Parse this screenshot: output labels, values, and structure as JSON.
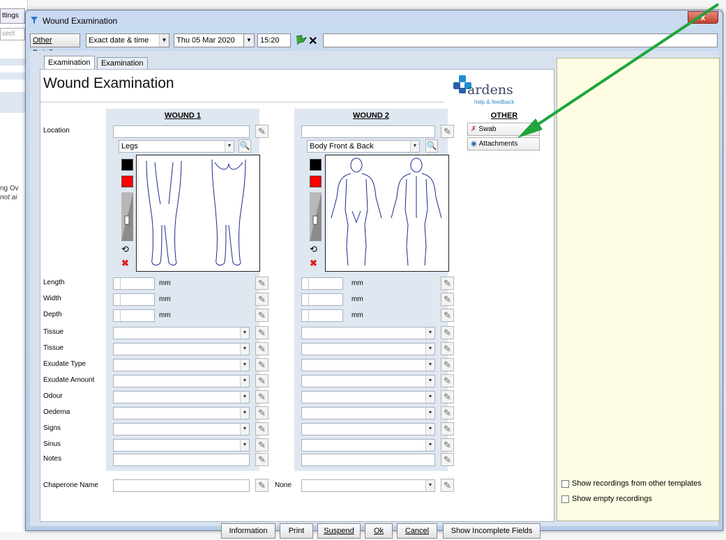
{
  "background_app": {
    "tab_text": "ttings",
    "search_text": "sect",
    "snippet_1": "ng Ov",
    "snippet_2": "not ai"
  },
  "window": {
    "title": "Wound Examination",
    "close_label": "x"
  },
  "toolbar": {
    "other_details": "Other Details...",
    "date_mode": "Exact date & time",
    "date": "Thu 05 Mar 2020",
    "time": "15:20"
  },
  "tabs": [
    {
      "label": "Examination",
      "active": true
    },
    {
      "label": "Examination",
      "active": false
    }
  ],
  "form": {
    "heading": "Wound Examination",
    "logo_text": "ardens",
    "logo_sub": "help & feedback"
  },
  "wound1": {
    "title": "WOUND 1",
    "location_value": "",
    "body_region": "Legs"
  },
  "wound2": {
    "title": "WOUND 2",
    "location_value": "",
    "body_region": "Body Front & Back"
  },
  "labels": {
    "location": "Location",
    "length": "Length",
    "width": "Width",
    "depth": "Depth",
    "tissue1": "Tissue",
    "tissue2": "Tissue",
    "exudate_type": "Exudate Type",
    "exudate_amount": "Exudate Amount",
    "odour": "Odour",
    "oedema": "Oedema",
    "signs": "Signs",
    "sinus": "Sinus",
    "notes": "Notes",
    "chaperone_name": "Chaperone Name",
    "none": "None",
    "unit": "mm"
  },
  "other": {
    "title": "OTHER",
    "swab": "Swab",
    "attachments": "Attachments"
  },
  "side_panel": {
    "show_other_templates": "Show recordings from other templates",
    "show_empty": "Show empty recordings"
  },
  "bottom": {
    "information": "Information",
    "print": "Print",
    "suspend": "Suspend",
    "ok": "Ok",
    "cancel": "Cancel",
    "show_incomplete": "Show Incomplete Fields"
  },
  "colors": {
    "annotation_arrow": "#1fa53b",
    "swatch_black": "#000000",
    "swatch_red": "#ff0000",
    "close_red": "#c3412e",
    "panel_yellow": "#fefde3"
  },
  "icons": {
    "title": "funnel-icon",
    "flag": "green-flag-icon",
    "clear": "x-icon",
    "pen": "pencil-icon",
    "zoom": "magnify-icon",
    "undo": "undo-icon",
    "delete": "red-x-icon",
    "swab": "swab-icon",
    "attachments": "eye-icon"
  }
}
